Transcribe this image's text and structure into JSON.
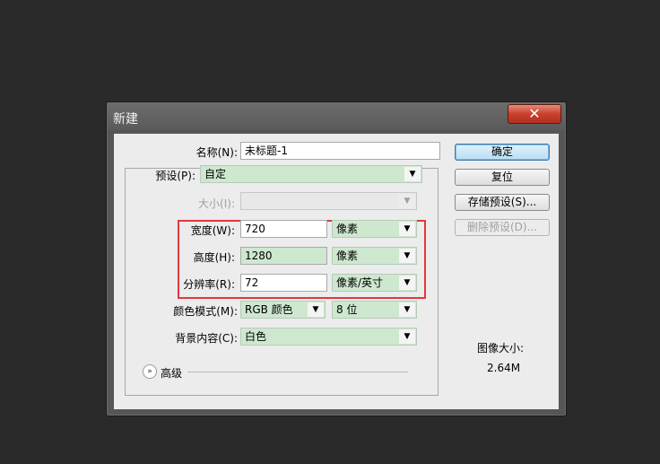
{
  "dialog": {
    "title": "新建",
    "close_glyph": "✕"
  },
  "form": {
    "name": {
      "label": "名称(N):",
      "value": "未标题-1"
    },
    "preset": {
      "label": "预设(P):",
      "value": "自定"
    },
    "size": {
      "label": "大小(I):",
      "value": ""
    },
    "width": {
      "label": "宽度(W):",
      "value": "720",
      "unit": "像素"
    },
    "height": {
      "label": "高度(H):",
      "value": "1280",
      "unit": "像素"
    },
    "resolution": {
      "label": "分辨率(R):",
      "value": "72",
      "unit": "像素/英寸"
    },
    "color_mode": {
      "label": "颜色模式(M):",
      "value": "RGB 颜色",
      "depth": "8 位"
    },
    "background": {
      "label": "背景内容(C):",
      "value": "白色"
    },
    "advanced": {
      "label": "高级"
    }
  },
  "buttons": {
    "ok": "确定",
    "reset": "复位",
    "save_preset": "存储预设(S)...",
    "delete_preset": "删除预设(D)..."
  },
  "image_size": {
    "label": "图像大小:",
    "value": "2.64M"
  },
  "icons": {
    "dropdown": "dropdown-arrow-icon",
    "close": "close-icon",
    "advanced": "expand-chevron-icon"
  },
  "colors": {
    "field_green": "#cde8cf",
    "highlight_red": "#e0393c",
    "primary_blue": "#3d7bad"
  }
}
